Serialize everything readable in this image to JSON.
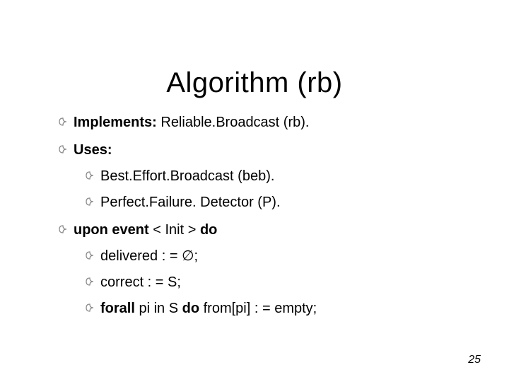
{
  "title": "Algorithm  (rb)",
  "items": {
    "implements_label": "Implements:",
    "implements_value": "  Reliable.Broadcast (rb).",
    "uses_label": "Uses:",
    "uses": {
      "beb": "Best.Effort.Broadcast (beb).",
      "pfd": "Perfect.Failure. Detector (P)."
    },
    "upon_prefix": "upon event ",
    "upon_mid": "< Init > ",
    "upon_do": "do",
    "init": {
      "delivered": "delivered : = ∅;",
      "correct": "correct : = S;",
      "forall_kw": "forall",
      "forall_mid": " pi in S ",
      "forall_do": "do",
      "forall_tail": " from[pi] : = empty;"
    }
  },
  "page_number": "25"
}
